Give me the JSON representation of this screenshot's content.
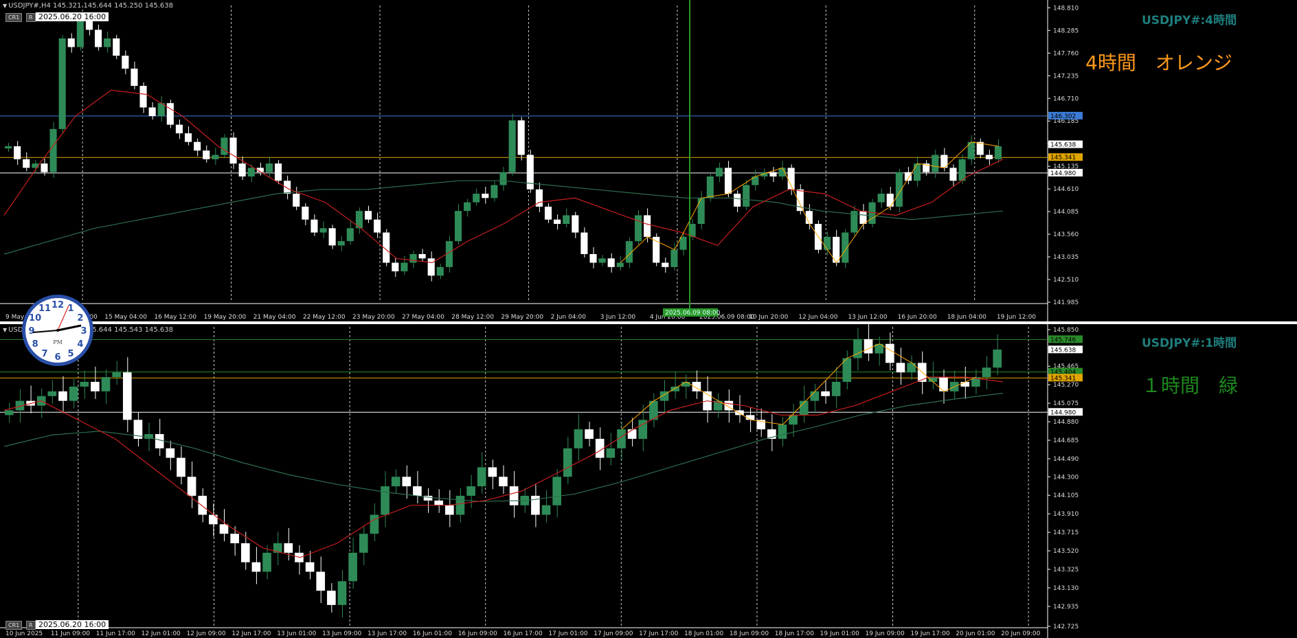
{
  "colors": {
    "background": "#000000",
    "bull": "#2e8b57",
    "bear": "#ffffff",
    "ma_fast": "#c81e1e",
    "ma_slow": "#2e6e4e",
    "zigzag_top": "#ffa500",
    "zigzag_bottom": "#ffa500",
    "hline_blue": "#3b7bd6",
    "hline_orange": "#e0a400",
    "hline_white": "#ffffff",
    "hline_green": "#2a8a2a",
    "title_teal": "#1f7e7e",
    "label_orange": "#ff9a1a",
    "label_green": "#1e8a1e"
  },
  "top": {
    "header": "USDJPY#,H4  145.321 145.644 145.250 145.638",
    "tag_a": "CR1",
    "tag_b": "R",
    "time_box": "2025.06.20 16:00",
    "symbol_title": "USDJPY#:4時間",
    "label": "4時間　オレンジ",
    "cursor_time": "2025.06.09 08:00"
  },
  "bottom": {
    "header": "USDJPY#,H1  145.321 145.644 145.543 145.638",
    "tag_a": "CR1",
    "tag_b": "R",
    "time_box": "2025.06.20 16:00",
    "symbol_title": "USDJPY#:1時間",
    "label": "１時間　緑"
  },
  "clock": {
    "period": "PM",
    "numbers": [
      "12",
      "1",
      "2",
      "3",
      "4",
      "5",
      "6",
      "7",
      "8",
      "9",
      "10",
      "11"
    ]
  },
  "chart_data": [
    {
      "type": "candlestick",
      "symbol": "USDJPY#",
      "timeframe": "H4",
      "ylim": [
        141.985,
        148.8
      ],
      "y_ticks": [
        "148.810",
        "148.285",
        "147.760",
        "147.235",
        "146.710",
        "146.185",
        "145.660",
        "145.135",
        "144.610",
        "144.085",
        "143.560",
        "143.035",
        "142.510",
        "141.985"
      ],
      "x_ticks": [
        "9 May 2025",
        "13 May 20:00",
        "15 May 04:00",
        "16 May 12:00",
        "19 May 20:00",
        "21 May 04:00",
        "22 May 12:00",
        "23 May 20:00",
        "27 May 04:00",
        "28 May 12:00",
        "29 May 20:00",
        "2 Jun 04:00",
        "3 Jun 12:00",
        "4 Jun 20:00",
        "2025.06.09 08:00",
        "10 Jun 20:00",
        "12 Jun 04:00",
        "13 Jun 12:00",
        "16 Jun 20:00",
        "18 Jun 04:00",
        "19 Jun 12:00"
      ],
      "h_lines": [
        {
          "price": 146.302,
          "label": "146.302",
          "color": "hline_blue"
        },
        {
          "price": 145.341,
          "label": "145.341",
          "color": "hline_orange"
        },
        {
          "price": 144.98,
          "label": "144.980",
          "color": "hline_white"
        }
      ],
      "current_price": "145.638",
      "closes": [
        145.6,
        145.3,
        145.1,
        145.2,
        145.0,
        146.0,
        148.1,
        147.9,
        148.5,
        148.3,
        147.9,
        148.1,
        147.7,
        147.4,
        147.0,
        146.5,
        146.3,
        146.6,
        146.1,
        145.9,
        145.7,
        145.5,
        145.3,
        145.4,
        145.8,
        145.2,
        144.9,
        145.1,
        145.0,
        145.2,
        144.8,
        144.5,
        144.2,
        143.9,
        143.6,
        143.7,
        143.3,
        143.4,
        143.7,
        144.1,
        143.9,
        143.6,
        142.9,
        142.7,
        142.9,
        143.1,
        143.0,
        142.6,
        142.8,
        143.4,
        144.1,
        144.3,
        144.5,
        144.4,
        144.7,
        145.0,
        146.2,
        145.4,
        144.6,
        144.2,
        143.9,
        143.8,
        144.0,
        143.6,
        143.1,
        142.9,
        143.0,
        142.8,
        142.9,
        143.4,
        144.0,
        143.5,
        142.9,
        142.8,
        143.2,
        143.5,
        143.8,
        144.4,
        144.9,
        145.1,
        144.5,
        144.2,
        144.7,
        144.9,
        145.0,
        144.9,
        145.1,
        144.6,
        144.1,
        143.8,
        143.2,
        143.5,
        142.9,
        143.6,
        144.1,
        143.8,
        144.3,
        144.5,
        144.2,
        145.0,
        144.8,
        145.2,
        145.0,
        145.4,
        145.1,
        144.8,
        145.3,
        145.7,
        145.4,
        145.3,
        145.6
      ],
      "ma_fast": [
        144.0,
        145.2,
        146.3,
        146.9,
        146.8,
        146.3,
        145.6,
        145.1,
        144.6,
        144.3,
        143.7,
        143.0,
        142.9,
        143.4,
        143.8,
        144.3,
        144.4,
        144.1,
        143.8,
        143.6,
        143.3,
        144.2,
        144.6,
        144.5,
        144.1,
        144.0,
        144.3,
        144.9,
        145.3
      ],
      "ma_slow": [
        143.1,
        143.4,
        143.7,
        143.9,
        144.1,
        144.3,
        144.5,
        144.6,
        144.6,
        144.7,
        144.8,
        144.8,
        144.7,
        144.6,
        144.5,
        144.4,
        144.4,
        144.3,
        144.1,
        144.0,
        143.9,
        144.0,
        144.1
      ]
    },
    {
      "type": "candlestick",
      "symbol": "USDJPY#",
      "timeframe": "H1",
      "ylim": [
        142.725,
        145.85
      ],
      "y_ticks": [
        "145.850",
        "145.655",
        "145.465",
        "145.270",
        "145.075",
        "144.880",
        "144.685",
        "144.490",
        "144.300",
        "144.105",
        "143.910",
        "143.715",
        "143.520",
        "143.325",
        "143.130",
        "142.935",
        "142.725"
      ],
      "x_ticks": [
        "10 Jun 2025",
        "11 Jun 09:00",
        "11 Jun 17:00",
        "12 Jun 01:00",
        "12 Jun 09:00",
        "12 Jun 17:00",
        "13 Jun 01:00",
        "13 Jun 09:00",
        "13 Jun 17:00",
        "16 Jun 01:00",
        "16 Jun 09:00",
        "16 Jun 17:00",
        "17 Jun 01:00",
        "17 Jun 09:00",
        "17 Jun 17:00",
        "18 Jun 01:00",
        "18 Jun 09:00",
        "18 Jun 17:00",
        "19 Jun 01:00",
        "19 Jun 09:00",
        "19 Jun 17:00",
        "20 Jun 01:00",
        "20 Jun 09:00"
      ],
      "h_lines": [
        {
          "price": 145.746,
          "label": "145.746",
          "color": "hline_green"
        },
        {
          "price": 145.404,
          "label": "145.404",
          "color": "hline_green"
        },
        {
          "price": 145.341,
          "label": "145.341",
          "color": "hline_orange"
        },
        {
          "price": 144.98,
          "label": "144.980",
          "color": "hline_white"
        }
      ],
      "current_price": "145.638",
      "closes": [
        145.0,
        145.1,
        145.05,
        145.15,
        145.2,
        145.1,
        145.25,
        145.3,
        145.2,
        145.35,
        145.4,
        144.9,
        144.7,
        144.75,
        144.6,
        144.5,
        144.3,
        144.1,
        143.9,
        143.8,
        143.7,
        143.6,
        143.4,
        143.3,
        143.5,
        143.6,
        143.5,
        143.4,
        143.3,
        143.1,
        142.95,
        143.2,
        143.5,
        143.7,
        143.9,
        144.2,
        144.3,
        144.2,
        144.1,
        144.05,
        144.0,
        143.9,
        144.1,
        144.2,
        144.4,
        144.3,
        144.2,
        144.0,
        144.1,
        143.9,
        144.0,
        144.3,
        144.6,
        144.8,
        144.7,
        144.5,
        144.6,
        144.8,
        144.7,
        144.9,
        145.1,
        145.2,
        145.25,
        145.3,
        145.2,
        145.0,
        145.1,
        145.0,
        144.95,
        144.9,
        144.8,
        144.7,
        144.85,
        144.95,
        145.1,
        145.2,
        145.15,
        145.3,
        145.55,
        145.75,
        145.6,
        145.7,
        145.5,
        145.4,
        145.5,
        145.3,
        145.35,
        145.2,
        145.3,
        145.25,
        145.35,
        145.45,
        145.64
      ],
      "ma_fast": [
        145.0,
        145.1,
        144.9,
        144.7,
        144.4,
        144.1,
        143.8,
        143.55,
        143.45,
        143.6,
        143.85,
        144.0,
        144.0,
        144.05,
        144.15,
        144.35,
        144.55,
        144.8,
        145.0,
        145.1,
        145.05,
        144.95,
        144.95,
        145.05,
        145.2,
        145.35,
        145.35,
        145.3
      ],
      "ma_slow": [
        144.62,
        144.74,
        144.78,
        144.72,
        144.6,
        144.45,
        144.32,
        144.22,
        144.14,
        144.08,
        144.04,
        144.05,
        144.12,
        144.25,
        144.4,
        144.55,
        144.7,
        144.82,
        144.95,
        145.05,
        145.12,
        145.18
      ]
    }
  ]
}
